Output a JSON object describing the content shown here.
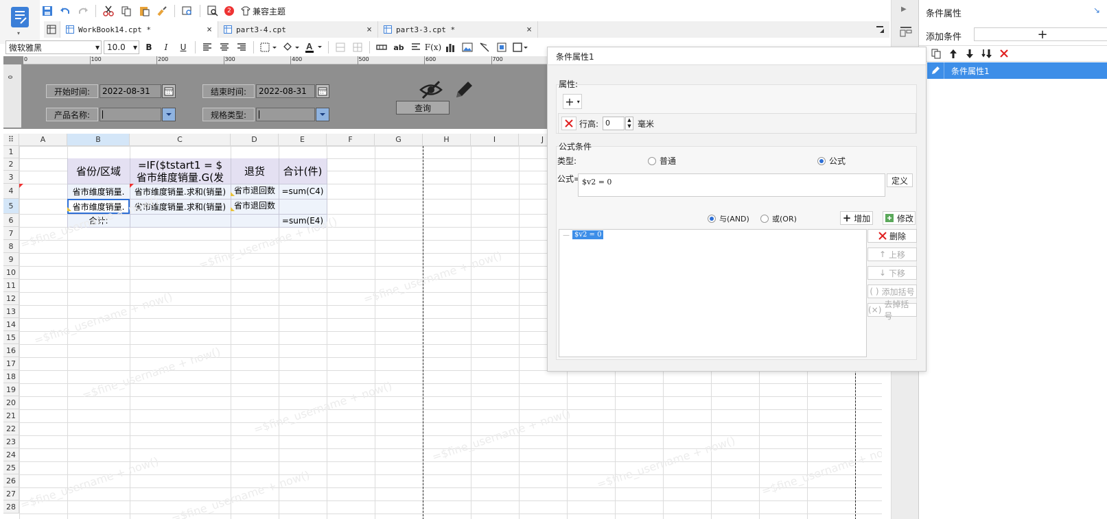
{
  "toolbar": {
    "compat_theme": "兼容主题",
    "badge": "2"
  },
  "tabs": [
    {
      "label": "WorkBook14.cpt *"
    },
    {
      "label": "part3-4.cpt"
    },
    {
      "label": "part3-3.cpt *"
    }
  ],
  "format": {
    "font_name": "微软雅黑",
    "font_size": "10.0"
  },
  "ruler": [
    "0",
    "100",
    "200",
    "300",
    "400",
    "500",
    "600",
    "700"
  ],
  "params": {
    "start_label": "开始时间:",
    "start_value": "2022-08-31",
    "end_label": "结束时间:",
    "end_value": "2022-08-31",
    "product_label": "产品名称:",
    "spec_label": "规格类型:",
    "query_label": "查询"
  },
  "grid": {
    "columns": [
      "A",
      "B",
      "C",
      "D",
      "E",
      "F",
      "G",
      "H",
      "I",
      "J"
    ],
    "rows": [
      "1",
      "2",
      "3",
      "4",
      "5",
      "6",
      "7",
      "8",
      "9",
      "10",
      "11",
      "12",
      "13",
      "14",
      "15",
      "16",
      "17",
      "18",
      "19",
      "20",
      "21",
      "22",
      "23",
      "24",
      "25",
      "26",
      "27",
      "28"
    ],
    "cells": {
      "b23": "省份/区域",
      "c23_line1": "=IF($tstart1 = $",
      "c23_line2": "省市维度销量.G(发",
      "d23": "退货",
      "e23": "合计(件)",
      "b4": "省市维度销量.",
      "c4": "省市维度销量.求和(销量)",
      "d4": "省市退回数",
      "e4": "=sum(C4)",
      "b5": "省市维度销量.",
      "c5": "省市维度销量.求和(销量)",
      "d5": "省市退回数",
      "b6": "合计:",
      "e6": "=sum(E4)"
    },
    "watermark": "=$fine_username + now()"
  },
  "right_panel": {
    "title": "条件属性",
    "add_condition": "添加条件",
    "list": [
      "条件属性1"
    ]
  },
  "dialog": {
    "title": "条件属性1",
    "attr_label": "属性:",
    "row_height_label": "行高:",
    "row_height_value": "0",
    "row_height_unit": "毫米",
    "formula_cond_label": "公式条件",
    "type_label": "类型:",
    "type_normal": "普通",
    "type_formula": "公式",
    "formula_label": "公式=",
    "formula_value": "$v2 = 0",
    "define_btn": "定义",
    "and_label": "与(AND)",
    "or_label": "或(OR)",
    "add_btn": "增加",
    "modify_btn": "修改",
    "list_item": "$v2 = 0",
    "delete_btn": "删除",
    "up_btn": "上移",
    "down_btn": "下移",
    "add_paren_btn": "添加括号",
    "remove_paren_btn": "去掉括号"
  },
  "colors": {
    "accent": "#2d6fd6",
    "selected_row": "#3d8ee8",
    "delete_red": "#e02020",
    "header_fill": "#e4e0f2",
    "param_bg": "#8f8f8f"
  }
}
